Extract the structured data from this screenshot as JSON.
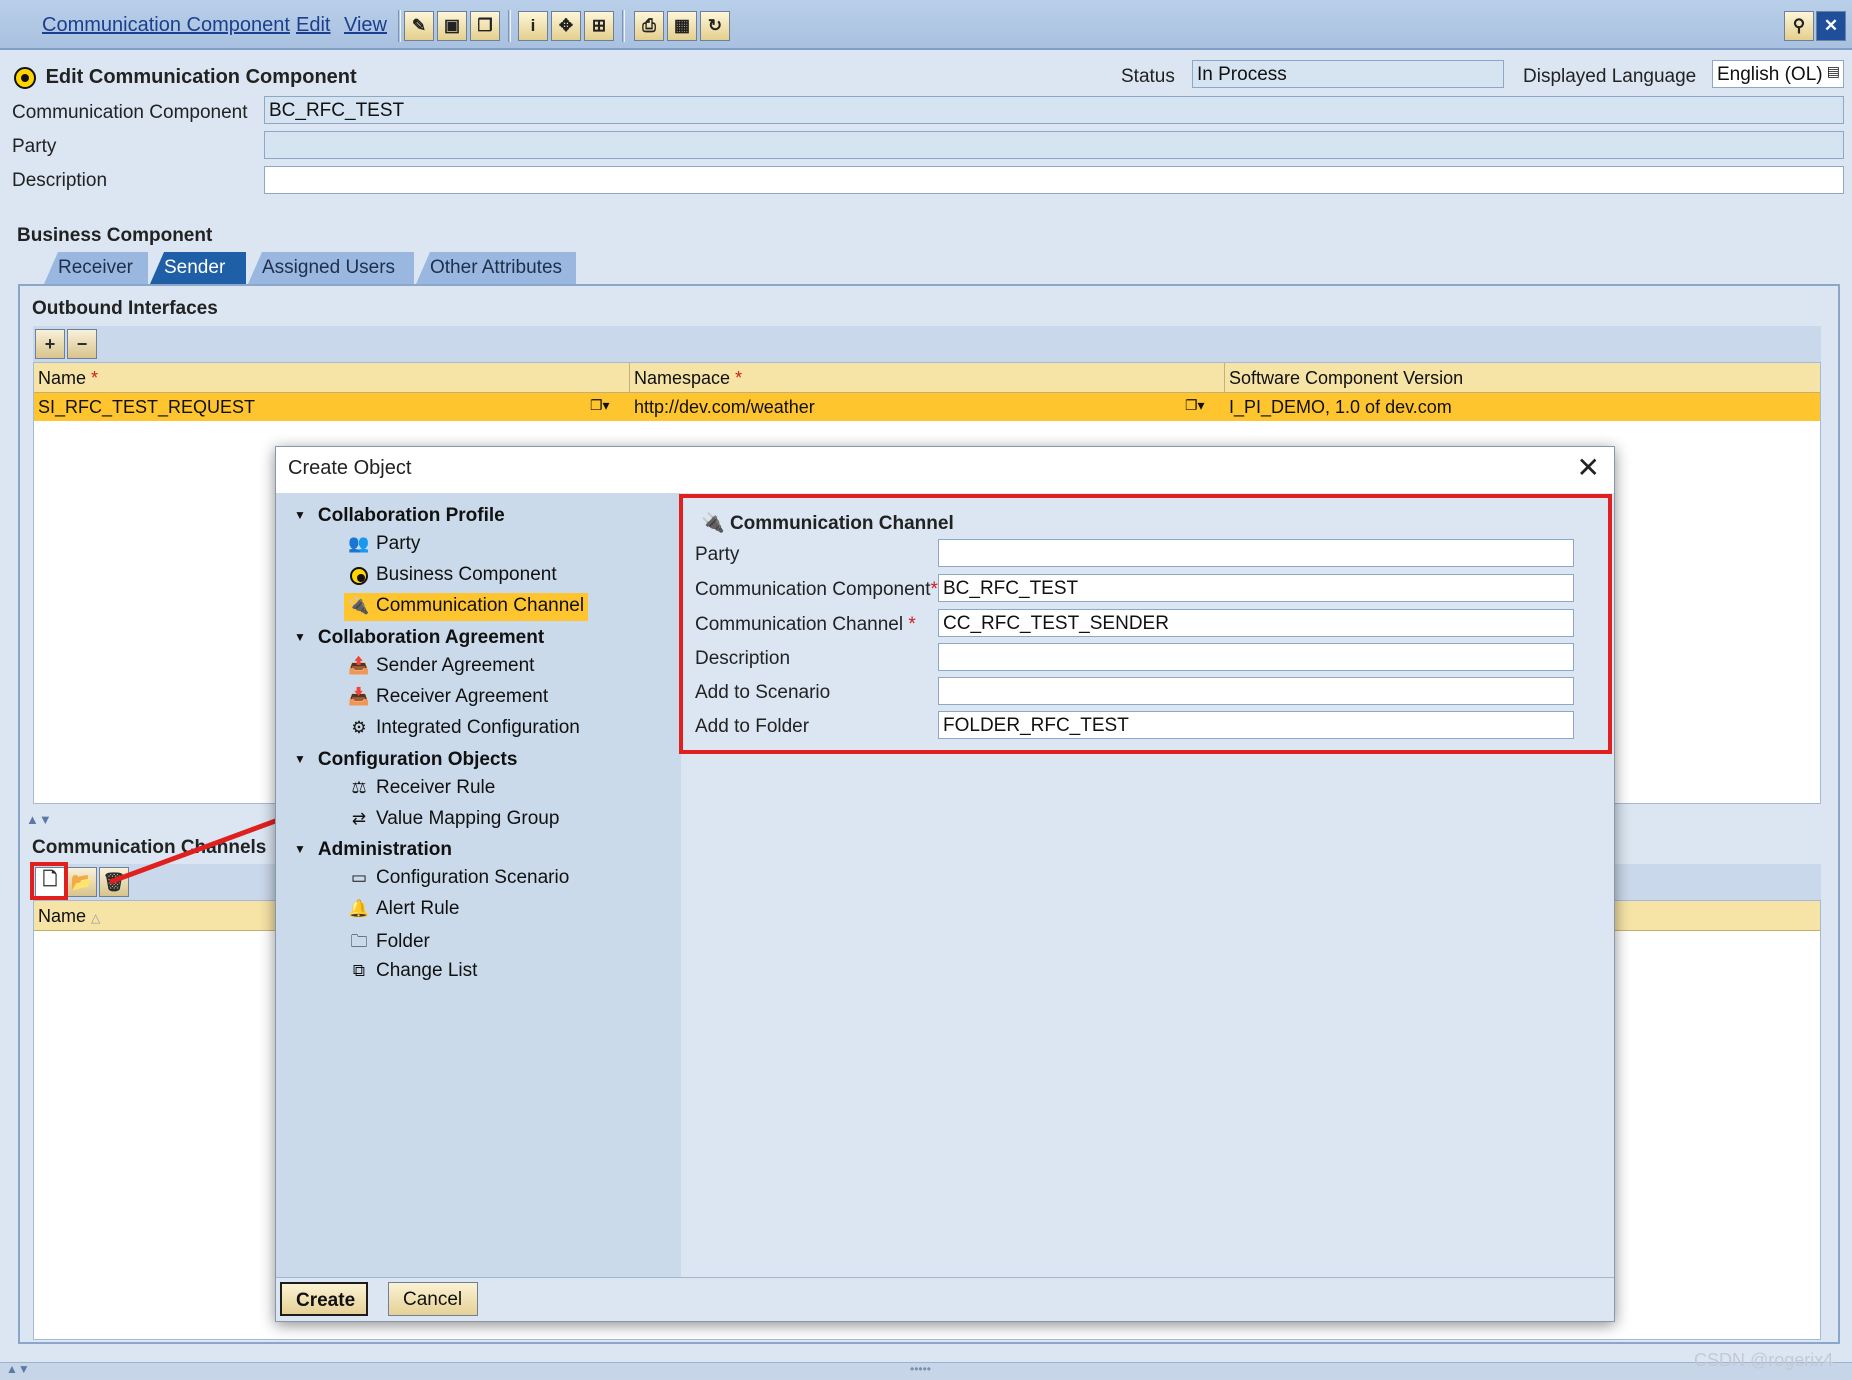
{
  "menubar": {
    "items": [
      "Communication Component",
      "Edit",
      "View"
    ]
  },
  "header": {
    "title": "Edit Communication Component",
    "status_label": "Status",
    "status_value": "In Process",
    "language_label": "Displayed Language",
    "language_value": "English (OL)",
    "comm_component_label": "Communication Component",
    "comm_component_value": "BC_RFC_TEST",
    "party_label": "Party",
    "party_value": "",
    "description_label": "Description",
    "description_value": ""
  },
  "business_component": {
    "title": "Business Component",
    "tabs": [
      "Receiver",
      "Sender",
      "Assigned Users",
      "Other Attributes"
    ],
    "active_tab": "Sender"
  },
  "outbound": {
    "title": "Outbound Interfaces",
    "columns": [
      "Name",
      "Namespace",
      "Software Component Version"
    ],
    "rows": [
      {
        "name": "SI_RFC_TEST_REQUEST",
        "namespace": "http://dev.com/weather",
        "scv": "I_PI_DEMO, 1.0 of dev.com"
      }
    ]
  },
  "channels": {
    "title": "Communication Channels",
    "column_name": "Name"
  },
  "dialog": {
    "title": "Create Object",
    "tree": [
      {
        "group": "Collaboration Profile",
        "items": [
          {
            "label": "Party",
            "icon": "party-icon",
            "selected": false
          },
          {
            "label": "Business Component",
            "icon": "business-component-icon",
            "selected": false
          },
          {
            "label": "Communication Channel",
            "icon": "communication-channel-icon",
            "selected": true
          }
        ]
      },
      {
        "group": "Collaboration Agreement",
        "items": [
          {
            "label": "Sender Agreement",
            "icon": "sender-agreement-icon",
            "selected": false
          },
          {
            "label": "Receiver Agreement",
            "icon": "receiver-agreement-icon",
            "selected": false
          },
          {
            "label": "Integrated Configuration",
            "icon": "integrated-configuration-icon",
            "selected": false
          }
        ]
      },
      {
        "group": "Configuration Objects",
        "items": [
          {
            "label": "Receiver Rule",
            "icon": "receiver-rule-icon",
            "selected": false
          },
          {
            "label": "Value Mapping Group",
            "icon": "value-mapping-icon",
            "selected": false
          }
        ]
      },
      {
        "group": "Administration",
        "items": [
          {
            "label": "Configuration Scenario",
            "icon": "configuration-scenario-icon",
            "selected": false
          },
          {
            "label": "Alert Rule",
            "icon": "alert-rule-icon",
            "selected": false
          },
          {
            "label": "Folder",
            "icon": "folder-icon",
            "selected": false
          },
          {
            "label": "Change List",
            "icon": "change-list-icon",
            "selected": false
          }
        ]
      }
    ],
    "form": {
      "title": "Communication Channel",
      "party_label": "Party",
      "party_value": "",
      "comp_label": "Communication Component",
      "comp_value": "BC_RFC_TEST",
      "channel_label": "Communication Channel",
      "channel_value": "CC_RFC_TEST_SENDER",
      "description_label": "Description",
      "description_value": "",
      "scenario_label": "Add to Scenario",
      "scenario_value": "",
      "folder_label": "Add to Folder",
      "folder_value": "FOLDER_RFC_TEST"
    },
    "create_label": "Create",
    "cancel_label": "Cancel"
  },
  "watermark": "CSDN @rogerix4",
  "colors": {
    "highlight": "#e0201e",
    "selection": "#ffc52e",
    "active_tab": "#1f5fa8"
  }
}
